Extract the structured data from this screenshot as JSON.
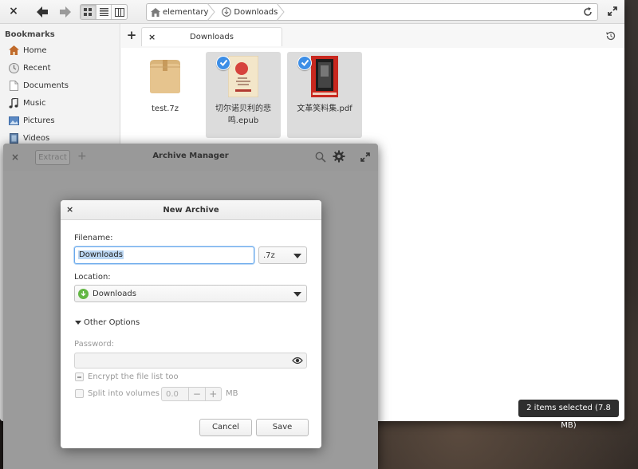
{
  "files_window": {
    "path": [
      "elementary",
      "Downloads"
    ],
    "sidebar": {
      "heading": "Bookmarks",
      "items": [
        {
          "label": "Home",
          "icon": "home-icon"
        },
        {
          "label": "Recent",
          "icon": "recent-icon"
        },
        {
          "label": "Documents",
          "icon": "documents-icon"
        },
        {
          "label": "Music",
          "icon": "music-icon"
        },
        {
          "label": "Pictures",
          "icon": "pictures-icon"
        },
        {
          "label": "Videos",
          "icon": "videos-icon"
        }
      ]
    },
    "tab": {
      "label": "Downloads"
    },
    "files": [
      {
        "name": "test.7z",
        "selected": false,
        "icon": "archive-icon"
      },
      {
        "name": "切尔诺贝利的悲鸣.epub",
        "selected": true,
        "icon": "epub-thumbnail"
      },
      {
        "name": "文革笑料集.pdf",
        "selected": true,
        "icon": "pdf-thumbnail"
      }
    ],
    "status": "2 items selected (7.8 MB)"
  },
  "archive_manager": {
    "title": "Archive Manager",
    "extract_label": "Extract"
  },
  "dialog": {
    "title": "New Archive",
    "filename_label": "Filename:",
    "filename_value": "Downloads",
    "extension": ".7z",
    "location_label": "Location:",
    "location_value": "Downloads",
    "other_options": "Other Options",
    "password_label": "Password:",
    "encrypt_label": "Encrypt the file list too",
    "split_label": "Split into volumes of",
    "split_value": "0.0",
    "split_unit": "MB",
    "cancel_label": "Cancel",
    "save_label": "Save"
  },
  "colors": {
    "accent": "#3d8ee6",
    "selection": "#dcdcdc",
    "overlay": "#9b9b9b"
  }
}
